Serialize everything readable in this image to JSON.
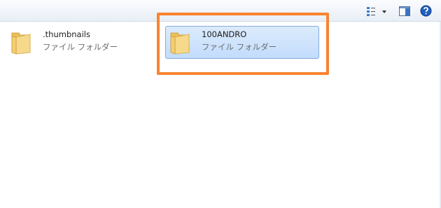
{
  "toolbar": {
    "views_icon": "change-view-icon",
    "preview_icon": "preview-pane-icon",
    "help_icon": "help-icon"
  },
  "folders": [
    {
      "name": ".thumbnails",
      "type": "ファイル フォルダー",
      "selected": false
    },
    {
      "name": "100ANDRO",
      "type": "ファイル フォルダー",
      "selected": true
    }
  ],
  "colors": {
    "highlight": "#f98431",
    "selection_fill": "#cce0fb",
    "selection_border": "#84acdd",
    "folder": "#f5d77c"
  }
}
